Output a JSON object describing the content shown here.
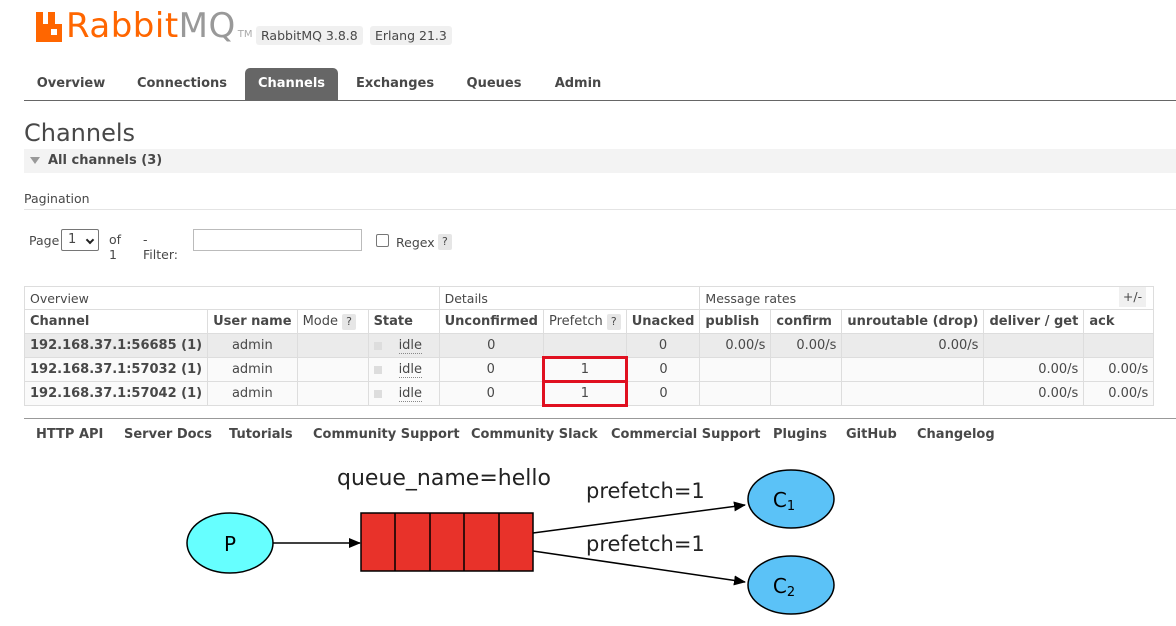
{
  "brand": {
    "name_a": "Rabbit",
    "name_b": "MQ",
    "tm": "TM"
  },
  "versions": {
    "rabbitmq": "RabbitMQ 3.8.8",
    "erlang": "Erlang 21.3"
  },
  "tabs": [
    {
      "label": "Overview",
      "active": false
    },
    {
      "label": "Connections",
      "active": false
    },
    {
      "label": "Channels",
      "active": true
    },
    {
      "label": "Exchanges",
      "active": false
    },
    {
      "label": "Queues",
      "active": false
    },
    {
      "label": "Admin",
      "active": false
    }
  ],
  "page_title": "Channels",
  "section": {
    "label": "All channels (3)"
  },
  "pagination": {
    "label": "Pagination",
    "page_label": "Page",
    "page_value": "1",
    "of_label": "of 1",
    "filter_label": "- Filter:",
    "filter_value": "",
    "regex_label": "Regex",
    "help": "?"
  },
  "table": {
    "groups": {
      "overview": "Overview",
      "details": "Details",
      "rates": "Message rates"
    },
    "plus_minus": "+/-",
    "headers": {
      "channel": "Channel",
      "user": "User name",
      "mode": "Mode",
      "state": "State",
      "unconfirmed": "Unconfirmed",
      "prefetch": "Prefetch",
      "unacked": "Unacked",
      "publish": "publish",
      "confirm": "confirm",
      "unroutable": "unroutable (drop)",
      "deliver": "deliver / get",
      "ack": "ack"
    },
    "rows": [
      {
        "channel": "192.168.37.1:56685 (1)",
        "user": "admin",
        "state": "idle",
        "unconfirmed": "0",
        "prefetch": "",
        "unacked": "0",
        "publish": "0.00/s",
        "confirm": "0.00/s",
        "unroutable": "0.00/s",
        "deliver": "",
        "ack": ""
      },
      {
        "channel": "192.168.37.1:57032 (1)",
        "user": "admin",
        "state": "idle",
        "unconfirmed": "0",
        "prefetch": "1",
        "unacked": "0",
        "publish": "",
        "confirm": "",
        "unroutable": "",
        "deliver": "0.00/s",
        "ack": "0.00/s"
      },
      {
        "channel": "192.168.37.1:57042 (1)",
        "user": "admin",
        "state": "idle",
        "unconfirmed": "0",
        "prefetch": "1",
        "unacked": "0",
        "publish": "",
        "confirm": "",
        "unroutable": "",
        "deliver": "0.00/s",
        "ack": "0.00/s"
      }
    ]
  },
  "footer_links": [
    "HTTP API",
    "Server Docs",
    "Tutorials",
    "Community Support",
    "Community Slack",
    "Commercial Support",
    "Plugins",
    "GitHub",
    "Changelog"
  ],
  "diagram": {
    "producer": "P",
    "queue_label": "queue_name=hello",
    "edge1": "prefetch=1",
    "edge2": "prefetch=1",
    "consumer1": "C",
    "consumer1_sub": "1",
    "consumer2": "C",
    "consumer2_sub": "2",
    "colors": {
      "producer": "#66ffff",
      "queue": "#e8322a",
      "consumer": "#5bc2f7"
    }
  }
}
